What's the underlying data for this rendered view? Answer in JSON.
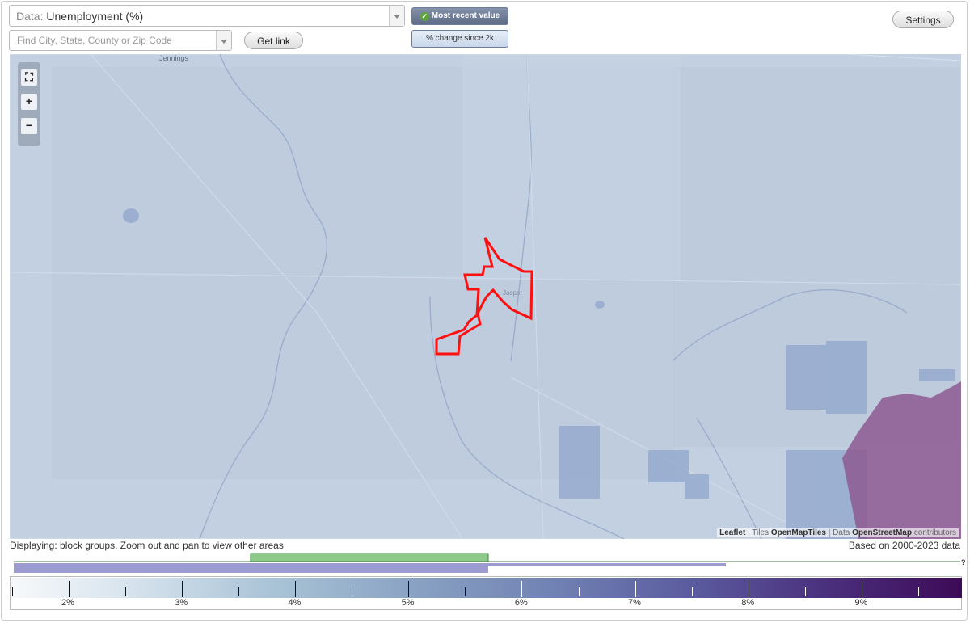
{
  "data_select": {
    "prefix": "Data:",
    "value": "Unemployment (%)"
  },
  "search": {
    "placeholder": "Find City, State, County or Zip Code"
  },
  "buttons": {
    "get_link": "Get link",
    "settings": "Settings"
  },
  "toggles": {
    "most_recent": "Most recent value",
    "change": "% change since 2k"
  },
  "map": {
    "place_labels": [
      "Jennings",
      "Jasper"
    ],
    "attribution": {
      "leaflet": "Leaflet",
      "sep1": " | Tiles ",
      "tiles": "OpenMapTiles",
      "sep2": " | Data ",
      "osm": "OpenStreetMap",
      "contrib": " contributors"
    }
  },
  "status": {
    "displaying": "Displaying: block groups. Zoom out and pan to view other areas",
    "based_on": "Based on 2000-2023 data"
  },
  "legend": {
    "labels": [
      "2%",
      "3%",
      "4%",
      "5%",
      "6%",
      "7%",
      "8%",
      "9%"
    ],
    "question_mark": "?",
    "colors": {
      "low": "#f7f9fb",
      "mid": "#8aa3c4",
      "high": "#3d0a57",
      "histogram_green": "#8fc98a",
      "histogram_purple": "#9c9cd0"
    }
  }
}
